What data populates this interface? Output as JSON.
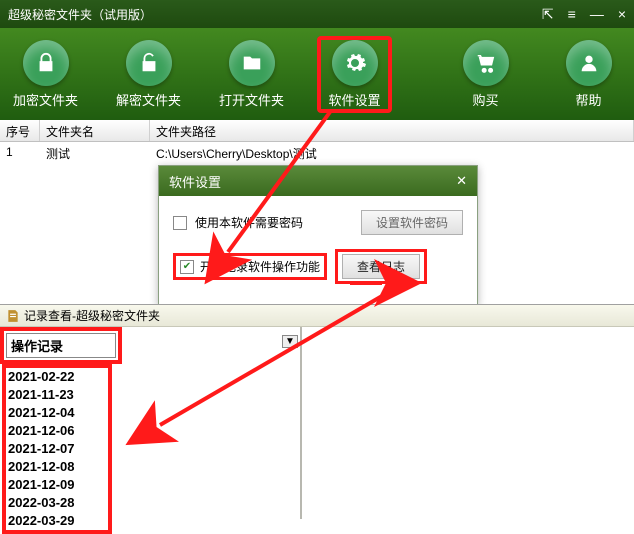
{
  "window": {
    "title": "超级秘密文件夹（试用版）",
    "controls": {
      "pin": "⇱",
      "menu": "≡",
      "min": "—",
      "close": "×"
    }
  },
  "toolbar": {
    "encrypt": {
      "label": "加密文件夹",
      "icon": "lock"
    },
    "decrypt": {
      "label": "解密文件夹",
      "icon": "unlock"
    },
    "open": {
      "label": "打开文件夹",
      "icon": "folder"
    },
    "settings": {
      "label": "软件设置",
      "icon": "gear"
    },
    "buy": {
      "label": "购买",
      "icon": "cart"
    },
    "help": {
      "label": "帮助",
      "icon": "user"
    }
  },
  "table": {
    "headers": {
      "index": "序号",
      "name": "文件夹名",
      "path": "文件夹路径"
    },
    "rows": [
      {
        "index": "1",
        "name": "测试",
        "path": "C:\\Users\\Cherry\\Desktop\\测试"
      }
    ]
  },
  "dialog": {
    "title": "软件设置",
    "close": "✕",
    "require_pw_label": "使用本软件需要密码",
    "set_pw_btn": "设置软件密码",
    "enable_log_label": "开启记录软件操作功能",
    "view_log_btn": "查看日志"
  },
  "logwin": {
    "title": "记录查看-超级秘密文件夹",
    "dropdown": "操作记录",
    "entries": [
      "2021-02-22",
      "2021-11-23",
      "2021-12-04",
      "2021-12-06",
      "2021-12-07",
      "2021-12-08",
      "2021-12-09",
      "2022-03-28",
      "2022-03-29"
    ]
  },
  "colors": {
    "highlight": "#ff1a1a",
    "toolbar_green": "#2f7513"
  }
}
